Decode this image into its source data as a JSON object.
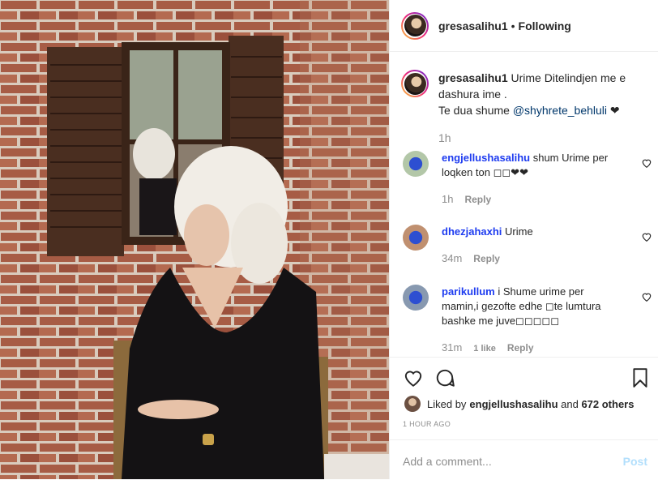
{
  "post": {
    "username": "gresasalihu1",
    "dot": "•",
    "follow_status": "Following"
  },
  "caption": {
    "username": "gresasalihu1",
    "line1": "Urime Ditelindjen me e dashura ime .",
    "line2_prefix": "Te dua shume ",
    "mention": "@shyhrete_behluli",
    "heart": "❤",
    "time": "1h"
  },
  "comments": [
    {
      "scribble": "engjellushasalihu",
      "text": "shum Urime per loqken ton ◻◻❤❤",
      "time": "1h",
      "reply": "Reply"
    },
    {
      "scribble": "dhezjahaxhi",
      "text": "Urime",
      "time": "34m",
      "reply": "Reply"
    },
    {
      "scribble": "parikullum",
      "text": "i Shume urime per mamin,i gezofte edhe ◻te lumtura bashke me juve◻◻◻◻◻",
      "time": "31m",
      "likes": "1 like",
      "reply": "Reply"
    }
  ],
  "likes": {
    "prefix": "Liked by ",
    "user": "engjellushasalihu",
    "suffix": " and ",
    "others": "672 others"
  },
  "timestamp": "1 HOUR AGO",
  "add_comment": {
    "placeholder": "Add a comment...",
    "post_label": "Post"
  },
  "colors": {
    "link": "#00376b",
    "post_disabled": "#b2dffc",
    "scribble": "#1e3cf0"
  }
}
